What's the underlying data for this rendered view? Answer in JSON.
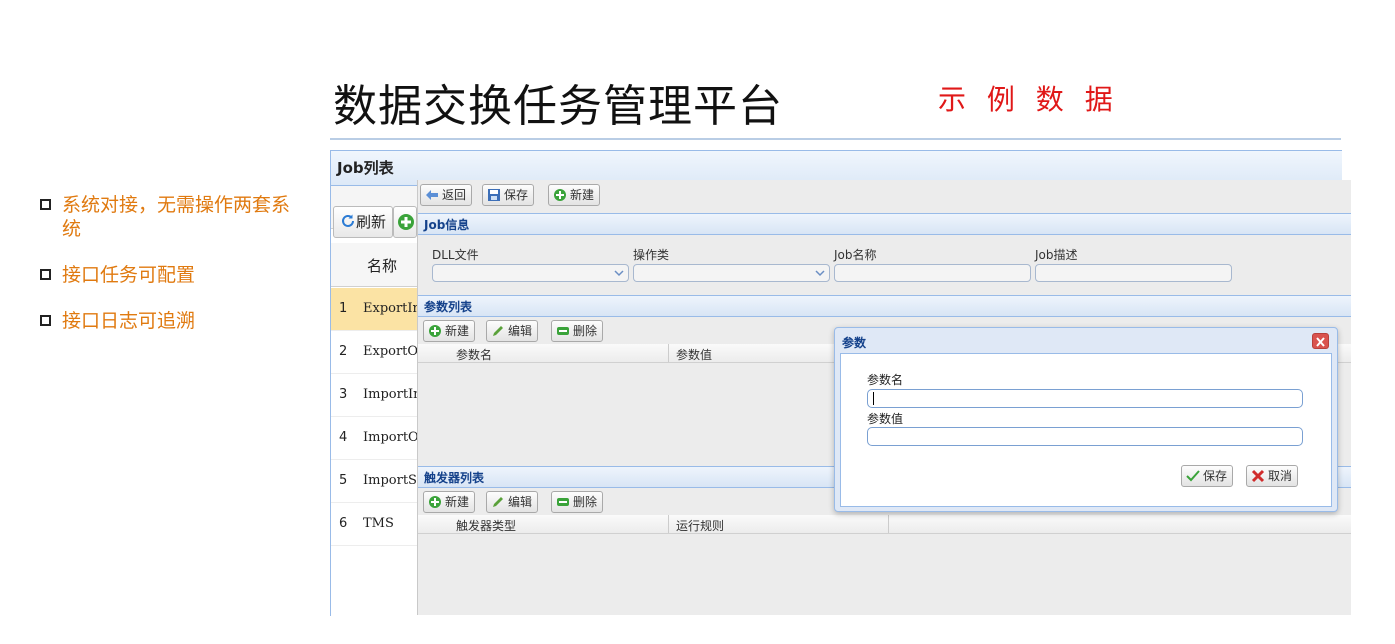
{
  "slide": {
    "title": "数据交换任务管理平台",
    "sample_label": "示 例 数 据"
  },
  "bullets": [
    "系统对接，无需操作两套系统",
    "接口任务可配置",
    "接口日志可追溯"
  ],
  "job_list": {
    "title": "Job列表",
    "refresh_label": "刷新",
    "name_column": "名称",
    "rows": [
      {
        "num": "1",
        "name": "ExportInb"
      },
      {
        "num": "2",
        "name": "ExportOut"
      },
      {
        "num": "3",
        "name": "ImportInb"
      },
      {
        "num": "4",
        "name": "ImportOut"
      },
      {
        "num": "5",
        "name": "ImportSKU"
      },
      {
        "num": "6",
        "name": "TMS"
      }
    ]
  },
  "detail": {
    "toolbar": {
      "back": "返回",
      "save": "保存",
      "new": "新建"
    },
    "job_info": {
      "title": "Job信息",
      "dll_label": "DLL文件",
      "op_label": "操作类",
      "name_label": "Job名称",
      "desc_label": "Job描述"
    },
    "params": {
      "title": "参数列表",
      "new": "新建",
      "edit": "编辑",
      "delete": "删除",
      "col_name": "参数名",
      "col_value": "参数值"
    },
    "triggers": {
      "title": "触发器列表",
      "new": "新建",
      "edit": "编辑",
      "delete": "删除",
      "col_type": "触发器类型",
      "col_rule": "运行规则"
    }
  },
  "dialog": {
    "title": "参数",
    "name_label": "参数名",
    "value_label": "参数值",
    "save": "保存",
    "cancel": "取消"
  }
}
